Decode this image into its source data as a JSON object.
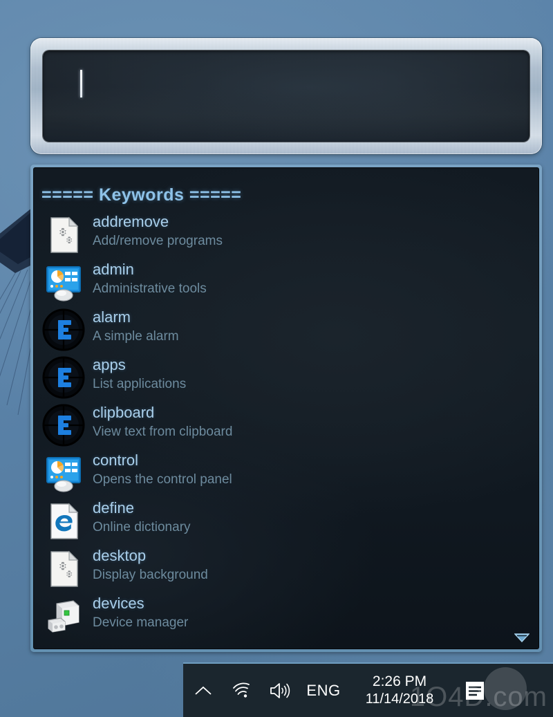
{
  "app": {
    "name": "Keyword Launcher",
    "accent_color": "#8ec2e8",
    "panel_background": "#121a22",
    "desktop_background": "#5f87ac",
    "title_color": "#a9cfeb",
    "description_color": "#6d8b9e"
  },
  "search": {
    "value": "",
    "placeholder": "",
    "caret_visible": true
  },
  "panel": {
    "header": "===== Keywords =====",
    "scroll_indicator": "chevron-down-icon",
    "items": [
      {
        "title": "addremove",
        "description": "Add/remove programs",
        "icon": "document-gears-icon"
      },
      {
        "title": "admin",
        "description": "Administrative tools",
        "icon": "control-panel-icon"
      },
      {
        "title": "alarm",
        "description": "A simple alarm",
        "icon": "crosshair-e-icon"
      },
      {
        "title": "apps",
        "description": "List applications",
        "icon": "crosshair-e-icon"
      },
      {
        "title": "clipboard",
        "description": "View text from clipboard",
        "icon": "crosshair-e-icon"
      },
      {
        "title": "control",
        "description": "Opens the control panel",
        "icon": "control-panel-icon"
      },
      {
        "title": "define",
        "description": "Online dictionary",
        "icon": "document-edge-icon"
      },
      {
        "title": "desktop",
        "description": "Display background",
        "icon": "document-gears-icon"
      },
      {
        "title": "devices",
        "description": "Device manager",
        "icon": "device-manager-icon"
      }
    ]
  },
  "taskbar": {
    "show_hidden_icons": "chevron-up-icon",
    "network": "wifi-icon",
    "volume": "speaker-icon",
    "language": "ENG",
    "clock": {
      "time": "2:26 PM",
      "date": "11/14/2018"
    },
    "action_center": "notification-icon",
    "watermark": "1O4D.com"
  }
}
